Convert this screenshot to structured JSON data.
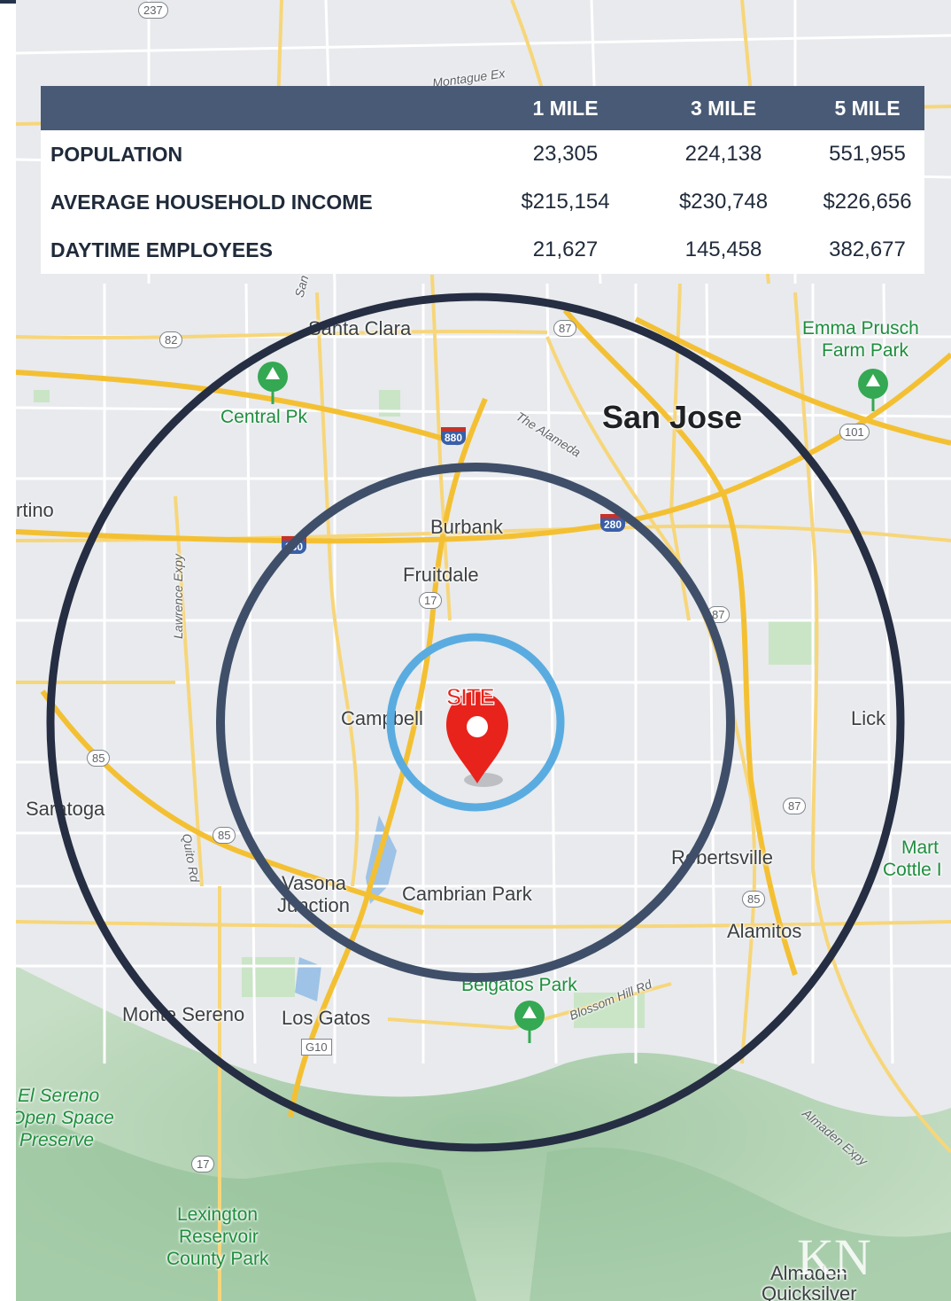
{
  "table": {
    "headers": [
      "",
      "1 MILE",
      "3 MILE",
      "5 MILE"
    ],
    "rows": [
      {
        "metric": "POPULATION",
        "values": [
          "23,305",
          "224,138",
          "551,955"
        ]
      },
      {
        "metric": "AVERAGE HOUSEHOLD INCOME",
        "values": [
          "$215,154",
          "$230,748",
          "$226,656"
        ]
      },
      {
        "metric": "DAYTIME EMPLOYEES",
        "values": [
          "21,627",
          "145,458",
          "382,677"
        ]
      }
    ]
  },
  "map": {
    "site_label": "SITE",
    "places": {
      "santa_clara": "Santa Clara",
      "san_jose": "San Jose",
      "burbank": "Burbank",
      "fruitdale": "Fruitdale",
      "campbell": "Campbell",
      "saratoga": "Saratoga",
      "vasona": "Vasona",
      "junction": "Junction",
      "cambrian_park": "Cambrian Park",
      "robertsville": "Robertsville",
      "alamitos": "Alamitos",
      "monte_sereno": "Monte Sereno",
      "los_gatos": "Los Gatos",
      "lick": "Lick",
      "cupertino": "rtino",
      "almaden_1": "Almaden",
      "almaden_2": "Quicksilver",
      "mart_1": "Mart",
      "mart_2": "Cottle I"
    },
    "parks": {
      "central_pk": "Central Pk",
      "emma_1": "Emma Prusch",
      "emma_2": "Farm Park",
      "belgatos": "Belgatos Park",
      "el_sereno_1": "El Sereno",
      "el_sereno_2": "Open Space",
      "el_sereno_3": "Preserve",
      "lexington_1": "Lexington",
      "lexington_2": "Reservoir",
      "lexington_3": "County Park"
    },
    "roads": {
      "montague": "Montague Ex",
      "alameda": "The Alameda",
      "lawrence": "Lawrence Expy",
      "quito": "Quito Rd",
      "blossom": "Blossom Hill Rd",
      "almaden_expy": "Almaden Expy",
      "san_tomas": "San"
    },
    "shields": [
      "237",
      "82",
      "87",
      "101",
      "880",
      "280",
      "17",
      "87",
      "85",
      "85",
      "87",
      "85",
      "G10",
      "17",
      "280"
    ],
    "radii_miles": [
      1,
      3,
      5
    ],
    "ring_colors": [
      "#5aace0",
      "#3f4f69",
      "#252e42"
    ],
    "pin_color": "#e8231b"
  },
  "logo": "KN"
}
